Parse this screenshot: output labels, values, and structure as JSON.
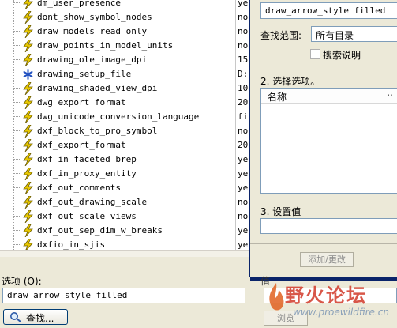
{
  "options": [
    {
      "name": "dm_user_presence",
      "value": "ye",
      "icon": "lightning-icon"
    },
    {
      "name": "dont_show_symbol_nodes",
      "value": "no",
      "icon": "lightning-icon"
    },
    {
      "name": "draw_models_read_only",
      "value": "no",
      "icon": "lightning-icon"
    },
    {
      "name": "draw_points_in_model_units",
      "value": "no",
      "icon": "lightning-icon"
    },
    {
      "name": "drawing_ole_image_dpi",
      "value": "15",
      "icon": "lightning-icon"
    },
    {
      "name": "drawing_setup_file",
      "value": "D:",
      "icon": "asterisk-icon"
    },
    {
      "name": "drawing_shaded_view_dpi",
      "value": "10",
      "icon": "lightning-icon"
    },
    {
      "name": "dwg_export_format",
      "value": "20",
      "icon": "lightning-icon"
    },
    {
      "name": "dwg_unicode_conversion_language",
      "value": "fi",
      "icon": "lightning-icon"
    },
    {
      "name": "dxf_block_to_pro_symbol",
      "value": "no",
      "icon": "lightning-icon"
    },
    {
      "name": "dxf_export_format",
      "value": "20",
      "icon": "lightning-icon"
    },
    {
      "name": "dxf_in_faceted_brep",
      "value": "ye",
      "icon": "lightning-icon"
    },
    {
      "name": "dxf_in_proxy_entity",
      "value": "ye",
      "icon": "lightning-icon"
    },
    {
      "name": "dxf_out_comments",
      "value": "ye",
      "icon": "lightning-icon"
    },
    {
      "name": "dxf_out_drawing_scale",
      "value": "no",
      "icon": "lightning-icon"
    },
    {
      "name": "dxf_out_scale_views",
      "value": "no",
      "icon": "lightning-icon"
    },
    {
      "name": "dxf_out_sep_dim_w_breaks",
      "value": "ye",
      "icon": "lightning-icon"
    },
    {
      "name": "dxfio_in_sjis",
      "value": "ye",
      "icon": "lightning-icon"
    }
  ],
  "search_panel": {
    "search_value": "draw_arrow_style filled",
    "scope_label": "查找范围:",
    "scope_value": "所有目录",
    "search_description_label": "搜索说明",
    "search_description_checked": false,
    "step2_label": "2.  选择选项。",
    "results_column_name": "名称",
    "results_column_desc": "..",
    "step3_label": "3.  设置值",
    "value_field": "",
    "add_change_label": "添加/更改",
    "value_label2": "值",
    "browse_label": "浏览"
  },
  "bottom": {
    "option_label": "选项 (O):",
    "option_value": "draw_arrow_style filled",
    "find_label": "查找..."
  },
  "watermark": {
    "text": "野火论坛",
    "url": "www.proewildfire.cn"
  },
  "colors": {
    "window_bg": "#ece9d8",
    "accent_dark_blue": "#0a246a",
    "lightning_yellow": "#e8c800",
    "asterisk_blue": "#2050c0"
  }
}
